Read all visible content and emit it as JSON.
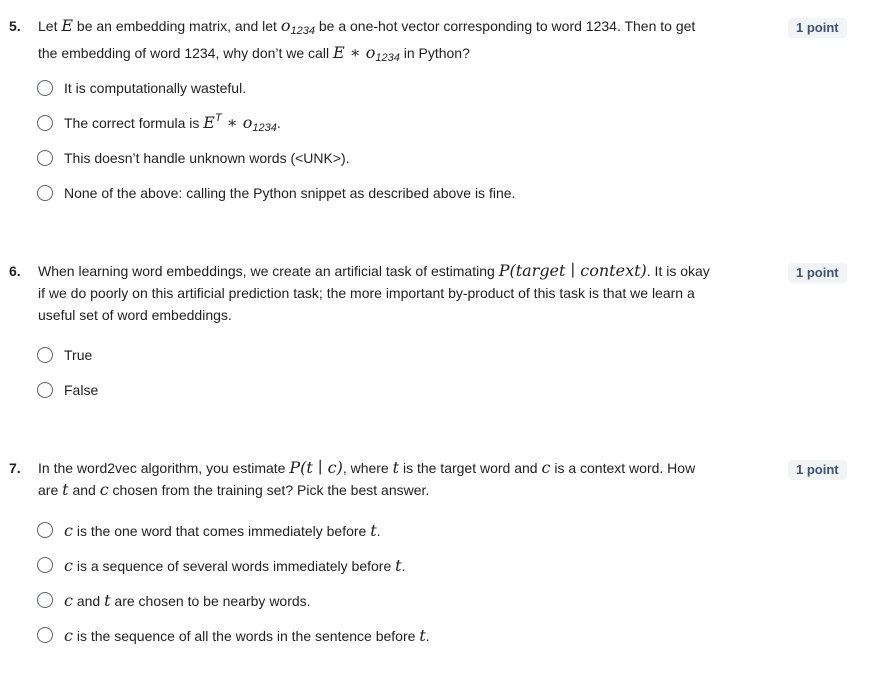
{
  "questions": [
    {
      "number": "5.",
      "points": "1 point",
      "text": {
        "p1": "Let ",
        "E": "E",
        "p2": " be an embedding matrix, and let ",
        "o": "o",
        "o_sub": "1234",
        "p3": " be a one-hot vector corresponding to word 1234. Then to get",
        "p4": "the embedding of word 1234, why don’t we call ",
        "E2": "E",
        "star": " ∗ ",
        "o2": "o",
        "o2_sub": "1234",
        "p5": " in Python?"
      },
      "options": [
        {
          "label": "It is computationally wasteful."
        },
        {
          "label_a": "The correct formula is ",
          "E": "E",
          "T": "T",
          "star": " ∗ ",
          "o": "o",
          "sub": "1234",
          "label_b": "."
        },
        {
          "label": "This doesn’t handle unknown words (<UNK>)."
        },
        {
          "label": "None of the above: calling the Python snippet as described above is fine."
        }
      ]
    },
    {
      "number": "6.",
      "points": "1 point",
      "text": {
        "p1": "When learning word embeddings, we create an artificial task of estimating ",
        "math": "P(target ∣ context)",
        "p2": ". It is okay",
        "p3": "if we do poorly on this artificial prediction task; the more important by-product of this task is that we learn a",
        "p4": "useful set of word embeddings."
      },
      "options": [
        {
          "label": "True"
        },
        {
          "label": "False"
        }
      ]
    },
    {
      "number": "7.",
      "points": "1 point",
      "text": {
        "p1": "In the word2vec algorithm, you estimate ",
        "math": "P(t ∣ c)",
        "p2": ", where ",
        "t": "t",
        "p3": " is the target word and ",
        "c": "c",
        "p4": " is a context word. How",
        "p5": "are ",
        "t2": "t",
        "p6": " and ",
        "c2": "c",
        "p7": " chosen from the training set? Pick the best answer."
      },
      "options": [
        {
          "c": "c",
          "label": " is the one word that comes immediately before ",
          "t": "t",
          "end": "."
        },
        {
          "c": "c",
          "label": " is a sequence of several words immediately before ",
          "t": "t",
          "end": "."
        },
        {
          "c": "c",
          "label": " and ",
          "t": "t",
          "end": " are chosen to be nearby words."
        },
        {
          "c": "c",
          "label": " is the sequence of all the words in the sentence before ",
          "t": "t",
          "end": "."
        }
      ]
    }
  ]
}
